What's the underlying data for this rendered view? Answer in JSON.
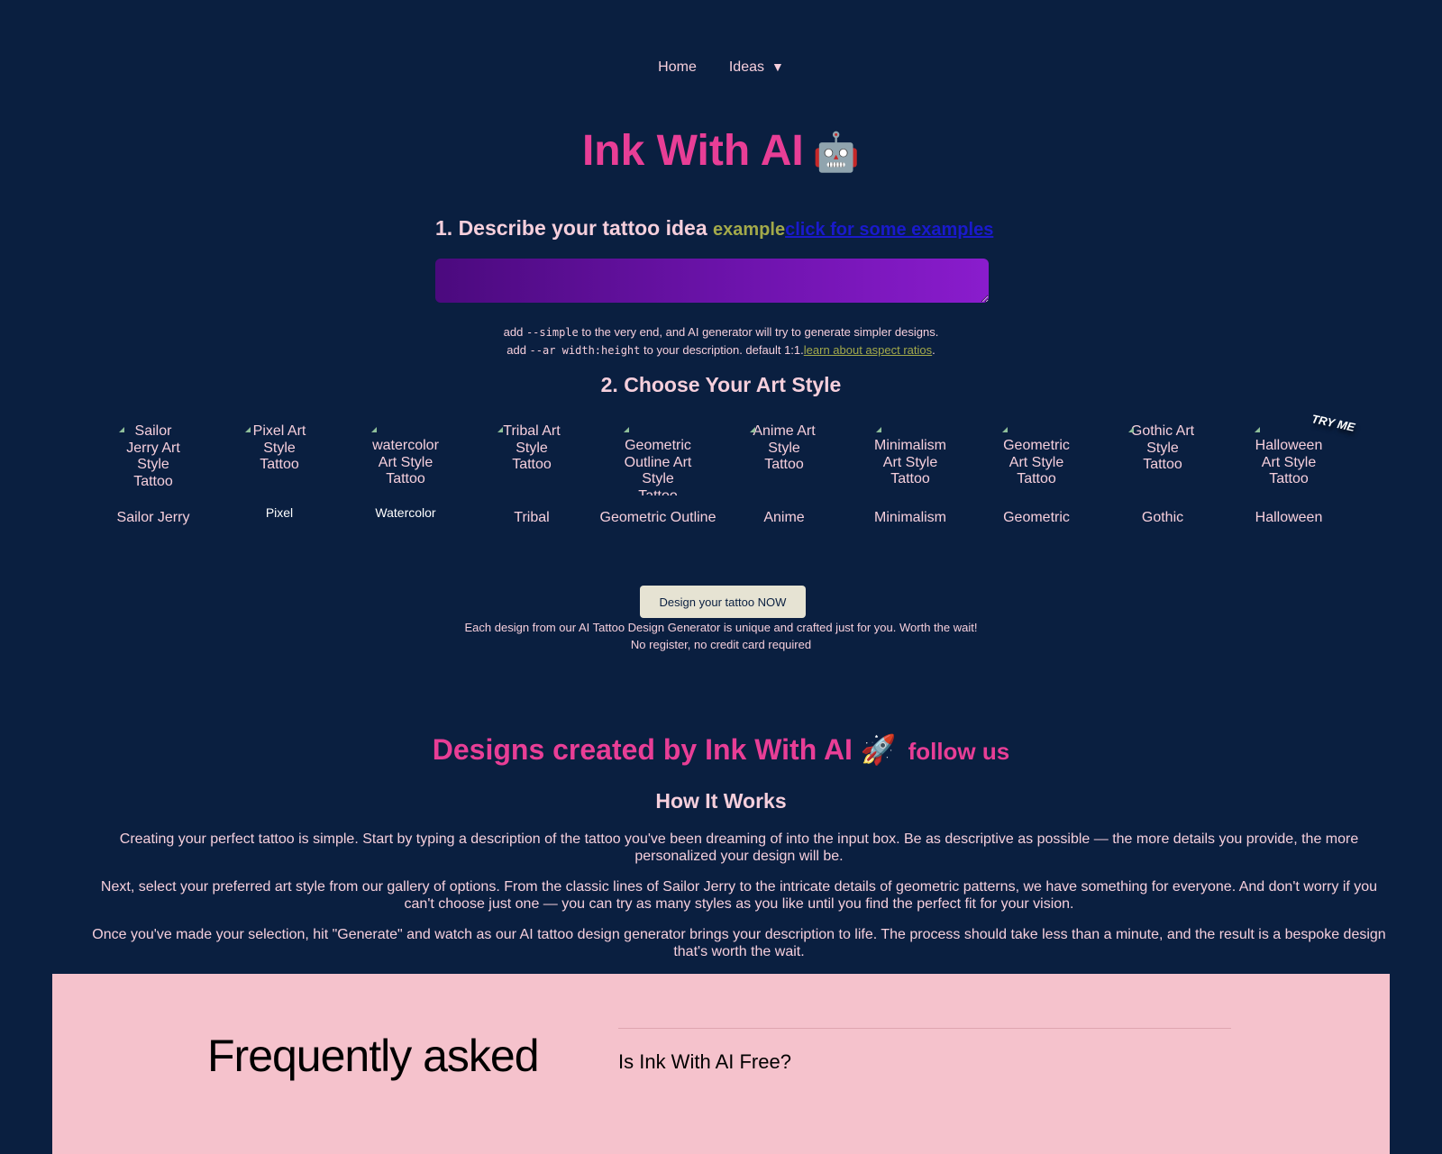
{
  "nav": {
    "items": [
      {
        "label": "Home"
      },
      {
        "label": "Ideas",
        "caret": "▼"
      }
    ]
  },
  "hero": {
    "title": "Ink With AI",
    "emoji": "🤖"
  },
  "step1": {
    "heading": "1. Describe your tattoo idea",
    "example_label": "example",
    "examples_link": "click for some examples",
    "textarea_value": "",
    "textarea_placeholder": ""
  },
  "hints": {
    "line1_prefix": "add ",
    "line1_code": "--simple",
    "line1_suffix": " to the very end, and AI generator will try to generate simpler designs.",
    "line2_prefix": "add ",
    "line2_code": "--ar width:height",
    "line2_suffix": " to your description. default 1:1.",
    "line2_link": "learn about aspect ratios",
    "line2_end": "."
  },
  "step2": {
    "heading": "2. Choose Your Art Style",
    "try_me": "TRY ME",
    "styles": [
      {
        "alt": "Sailor Jerry Art Style Tattoo",
        "label": "Sailor Jerry"
      },
      {
        "alt": "Pixel Art Style Tattoo",
        "label": "Pixel"
      },
      {
        "alt": "watercolor Art Style Tattoo",
        "label": "Watercolor"
      },
      {
        "alt": "Tribal Art Style Tattoo",
        "label": "Tribal"
      },
      {
        "alt": "Geometric Outline Art Style Tattoo",
        "label": "Geometric Outline"
      },
      {
        "alt": "Anime Art Style Tattoo",
        "label": "Anime"
      },
      {
        "alt": "Minimalism Art Style Tattoo",
        "label": "Minimalism"
      },
      {
        "alt": "Geometric Art Style Tattoo",
        "label": "Geometric"
      },
      {
        "alt": "Gothic Art Style Tattoo",
        "label": "Gothic"
      },
      {
        "alt": "Halloween Art Style Tattoo",
        "label": "Halloween"
      }
    ]
  },
  "cta": {
    "button_label": "Design your tattoo NOW",
    "note_line1": "Each design from our AI Tattoo Design Generator is unique and crafted just for you. Worth the wait!",
    "note_line2": "No register, no credit card required"
  },
  "designs": {
    "heading": "Designs created by Ink With AI",
    "emoji": "🚀",
    "follow_link": "follow us"
  },
  "how": {
    "heading": "How It Works",
    "paragraphs": [
      "Creating your perfect tattoo is simple. Start by typing a description of the tattoo you've been dreaming of into the input box. Be as descriptive as possible — the more details you provide, the more personalized your design will be.",
      "Next, select your preferred art style from our gallery of options. From the classic lines of Sailor Jerry to the intricate details of geometric patterns, we have something for everyone. And don't worry if you can't choose just one — you can try as many styles as you like until you find the perfect fit for your vision.",
      "Once you've made your selection, hit \"Generate\" and watch as our AI tattoo design generator brings your description to life. The process should take less than a minute, and the result is a bespoke design that's worth the wait."
    ]
  },
  "faq": {
    "title": "Frequently asked",
    "questions": [
      "Is Ink With AI Free?"
    ]
  }
}
